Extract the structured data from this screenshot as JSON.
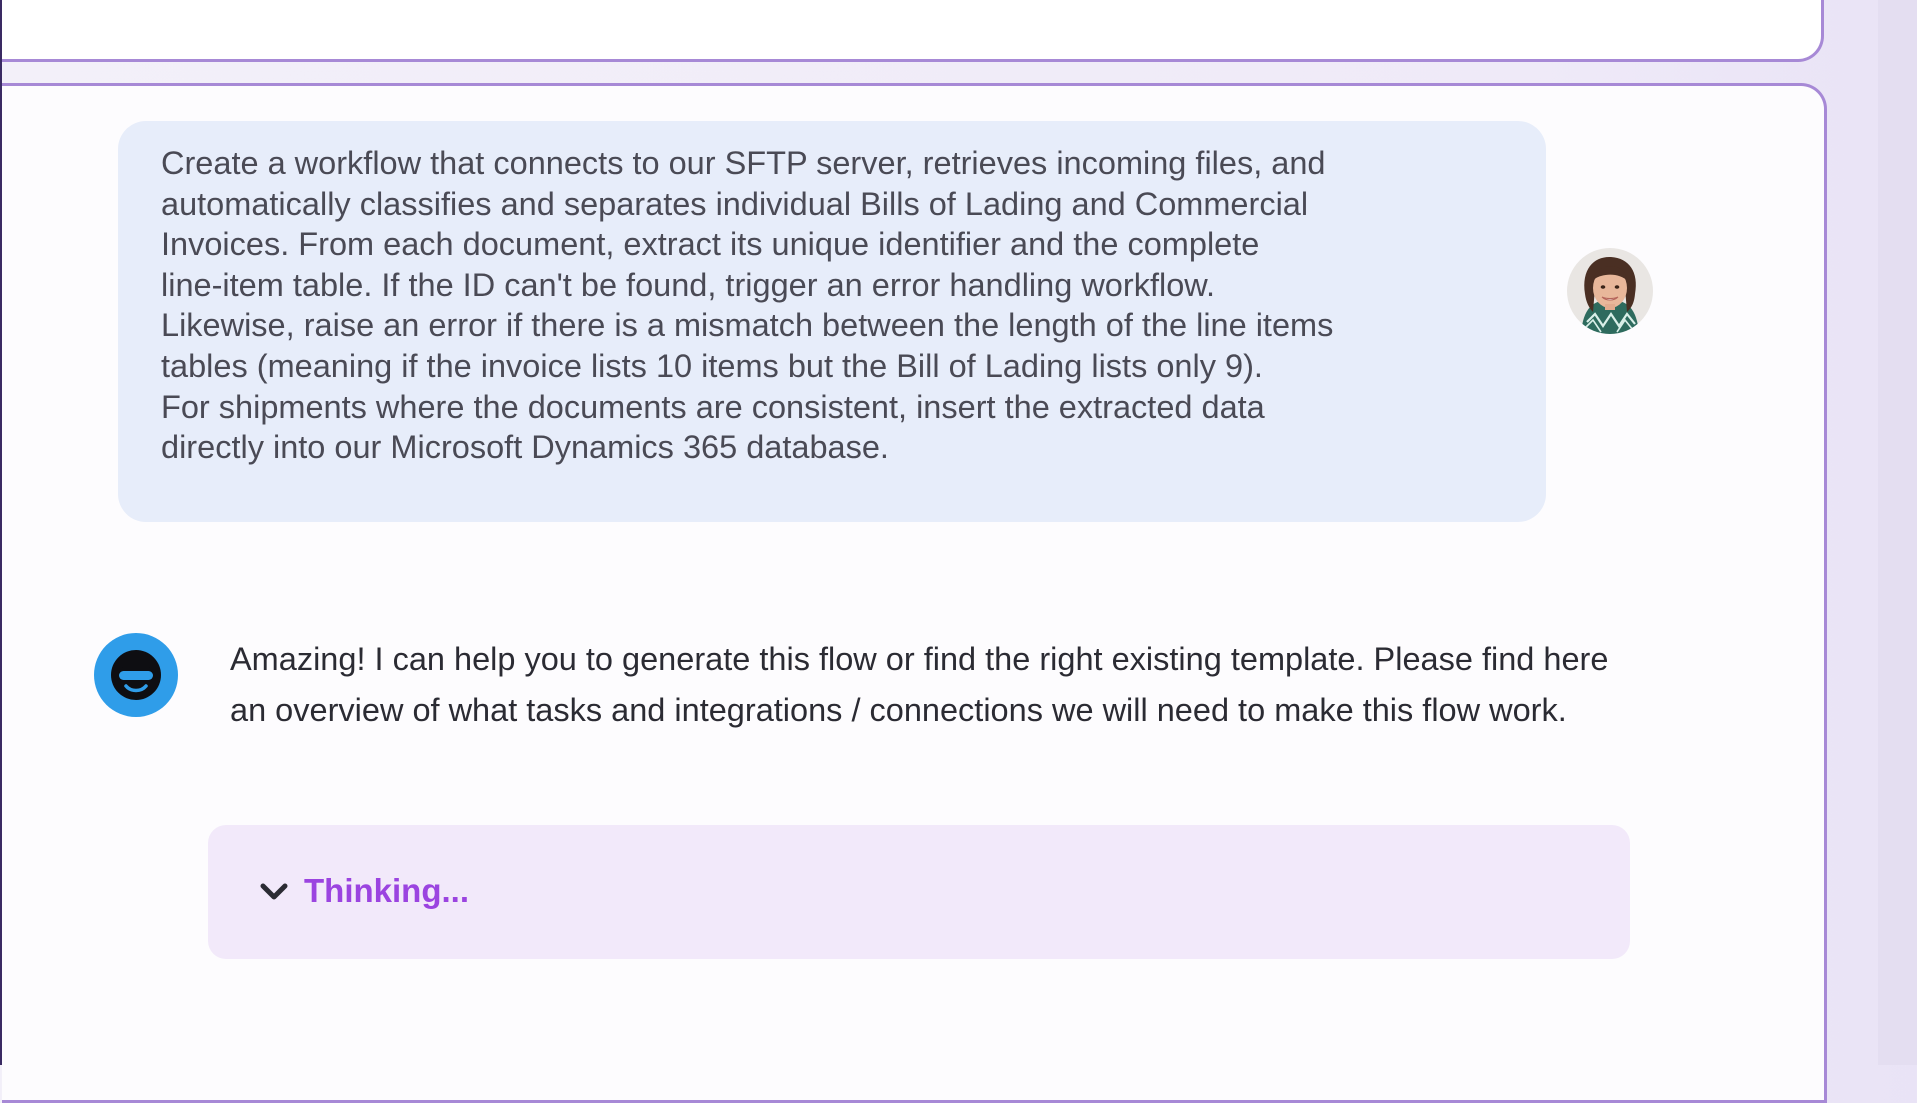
{
  "conversation": {
    "user_message": {
      "text": "Create a workflow that connects to our SFTP server, retrieves incoming files, and\nautomatically classifies and separates individual Bills of Lading and Commercial\nInvoices. From each document, extract its unique identifier and the complete\nline-item table. If the ID can't be found, trigger an error handling workflow.\nLikewise, raise an error if there is a mismatch between the length of the line items\ntables (meaning if the invoice lists 10 items but the Bill of Lading lists only 9).\nFor shipments where the documents are consistent, insert the extracted data\ndirectly into our Microsoft Dynamics 365 database.",
      "avatar_icon": "user-avatar-photo"
    },
    "assistant_message": {
      "text": "Amazing! I can help you to generate this flow or find the right existing template. Please find here an overview of what tasks and integrations / connections we will need to make this flow work.",
      "avatar_icon": "assistant-smiley-icon",
      "thinking": {
        "label": "Thinking...",
        "icon": "chevron-down-icon"
      }
    }
  },
  "colors": {
    "user_bubble": "#e7edfa",
    "assistant_avatar": "#2f9de9",
    "thinking_background": "#f2e9fa",
    "thinking_accent": "#9b44e0",
    "panel_border": "#a789d6"
  }
}
